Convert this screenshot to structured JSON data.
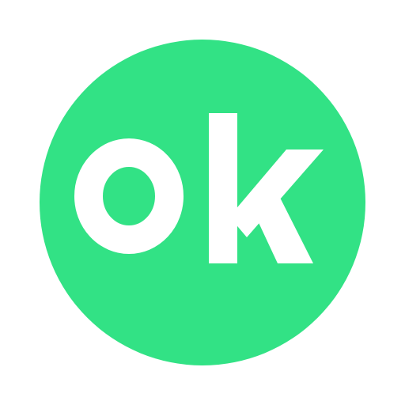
{
  "badge": {
    "text": "ok",
    "background_color": "#32e285",
    "text_color": "#ffffff"
  }
}
